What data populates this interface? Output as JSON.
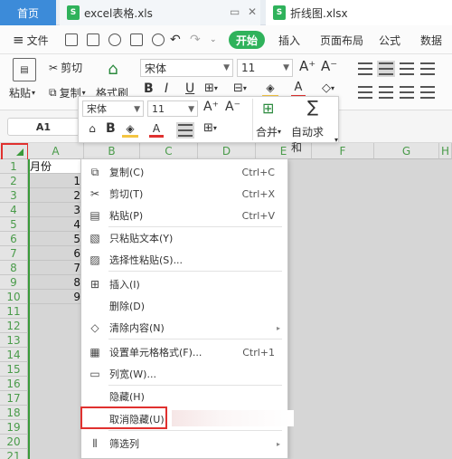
{
  "tabs": {
    "home": "首页",
    "file1": "excel表格.xls",
    "file2": "折线图.xlsx",
    "icons": [
      "s-logo-icon",
      "doc-icon"
    ]
  },
  "menu": {
    "file": "文件",
    "start": "开始",
    "insert": "插入",
    "page_layout": "页面布局",
    "formula": "公式",
    "data": "数据"
  },
  "ribbon": {
    "cut": "剪切",
    "paste": "粘贴",
    "copy": "复制",
    "format_painter": "格式刷",
    "font": "宋体",
    "font_size": "11",
    "bold": "B",
    "italic": "I",
    "underline": "U"
  },
  "namebox": "A1",
  "mini_toolbar": {
    "font": "宋体",
    "font_size": "11",
    "bold": "B",
    "merge": "合并",
    "autosum": "自动求和"
  },
  "columns": [
    "A",
    "B",
    "C",
    "D",
    "E",
    "F",
    "G",
    "H"
  ],
  "rows": [
    "1",
    "2",
    "3",
    "4",
    "5",
    "6",
    "7",
    "8",
    "9",
    "10",
    "11",
    "12",
    "13",
    "14",
    "15",
    "16",
    "17",
    "18",
    "19",
    "20",
    "21"
  ],
  "cells": {
    "a1": "月份",
    "col_a_values": [
      "1",
      "2",
      "3",
      "4",
      "5",
      "6",
      "7",
      "8",
      "9"
    ]
  },
  "context_menu": [
    {
      "label": "复制(C)",
      "shortcut": "Ctrl+C",
      "icon": "copy-icon"
    },
    {
      "label": "剪切(T)",
      "shortcut": "Ctrl+X",
      "icon": "scissors-icon"
    },
    {
      "label": "粘贴(P)",
      "shortcut": "Ctrl+V",
      "icon": "paste-icon"
    },
    {
      "label": "只粘贴文本(Y)",
      "shortcut": "",
      "icon": "paste-text-icon"
    },
    {
      "label": "选择性粘贴(S)...",
      "shortcut": "",
      "icon": "paste-special-icon"
    },
    {
      "label": "插入(I)",
      "shortcut": "",
      "icon": "insert-icon"
    },
    {
      "label": "删除(D)",
      "shortcut": "",
      "icon": ""
    },
    {
      "label": "清除内容(N)",
      "shortcut": "",
      "icon": "eraser-icon"
    },
    {
      "label": "设置单元格格式(F)...",
      "shortcut": "Ctrl+1",
      "icon": "format-cells-icon"
    },
    {
      "label": "列宽(W)...",
      "shortcut": "",
      "icon": "column-width-icon"
    },
    {
      "label": "隐藏(H)",
      "shortcut": "",
      "icon": ""
    },
    {
      "label": "取消隐藏(U)",
      "shortcut": "",
      "icon": ""
    },
    {
      "label": "筛选列",
      "shortcut": "",
      "icon": "filter-column-icon"
    }
  ],
  "colors": {
    "accent_blue": "#3c8bd9",
    "start_green": "#2fb25b",
    "highlight_red": "#e0312f",
    "header_green": "#4a9b4a"
  }
}
